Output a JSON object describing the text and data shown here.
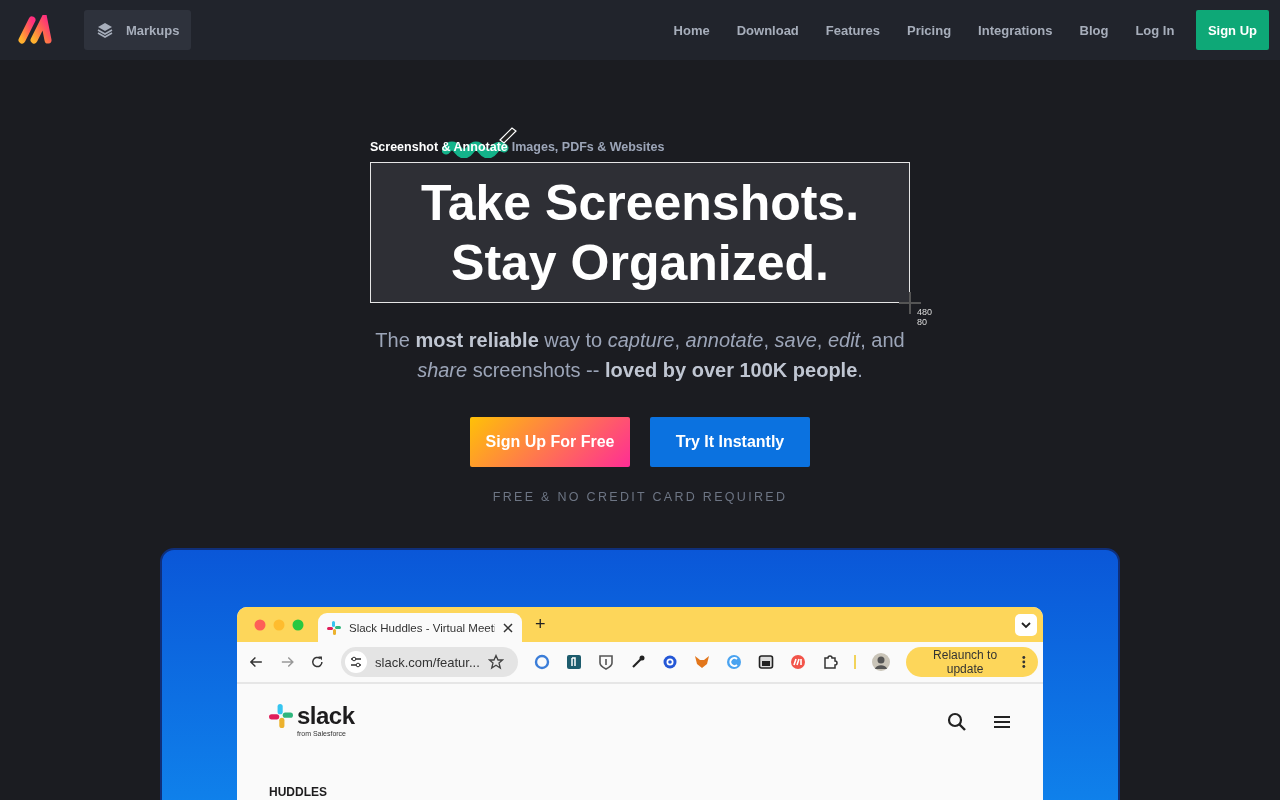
{
  "nav": {
    "product": "Markups",
    "links": [
      {
        "label": "Home"
      },
      {
        "label": "Download"
      },
      {
        "label": "Features"
      },
      {
        "label": "Pricing"
      },
      {
        "label": "Integrations"
      },
      {
        "label": "Blog"
      },
      {
        "label": "Log In"
      }
    ],
    "signup": "Sign Up"
  },
  "hero": {
    "eyebrow_lead": "Screenshot & Annotate",
    "eyebrow_rest": "Images, PDFs & Websites",
    "headline": [
      "Take Screenshots.",
      "Stay Organized."
    ],
    "selection_size": [
      "480",
      "80"
    ],
    "subtitle": "The **most reliable** way to *capture*, *annotate*, *save*, *edit*, and *share* screenshots -- **loved by over 100K people**.",
    "buttons": [
      {
        "label": "Sign Up For Free",
        "kind": "gradient"
      },
      {
        "label": "Try It Instantly",
        "kind": "solid"
      }
    ],
    "note": "FREE & NO CREDIT CARD REQUIRED"
  },
  "demo": {
    "tab_title": "Slack Huddles - Virtual Meeti",
    "new_tab": "+",
    "url": "slack.com/featur...",
    "relaunch": "Relaunch to update",
    "site_logo": "slack",
    "site_logo_sub": "from Salesforce",
    "section_label": "HUDDLES"
  }
}
